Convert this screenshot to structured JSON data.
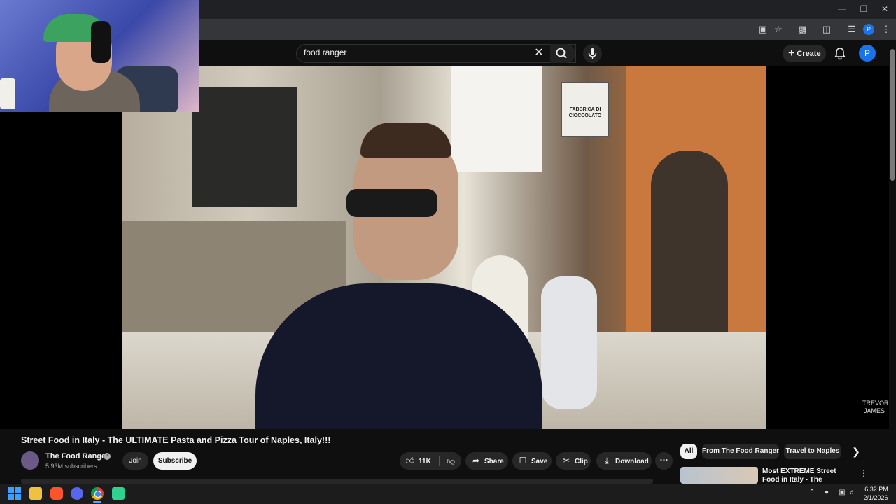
{
  "search": {
    "query": "food ranger"
  },
  "header": {
    "create_label": "Create",
    "avatar_letter": "P"
  },
  "browser": {
    "profile_letter": "P"
  },
  "video": {
    "title": "Street Food in Italy - The ULTIMATE Pasta and Pizza Tour of Naples, Italy!!!",
    "overlay_sign": "FABBRICA DI CIOCCOLATO",
    "watermark_line1": "TREVOR",
    "watermark_line2": "JAMES"
  },
  "channel": {
    "name": "The Food Ranger",
    "subscribers": "5.93M subscribers",
    "join_label": "Join",
    "subscribe_label": "Subscribe"
  },
  "actions": {
    "like_count": "11K",
    "share_label": "Share",
    "save_label": "Save",
    "clip_label": "Clip",
    "download_label": "Download"
  },
  "chips": [
    "All",
    "From The Food Ranger",
    "Travel to Naples"
  ],
  "recommendation": {
    "title": "Most EXTREME Street Food in Italy - The ULTIMATE Street"
  },
  "taskbar": {
    "time": "6:32 PM",
    "date": "2/1/2026"
  },
  "colors": {
    "background": "#0f0f0f",
    "pill": "#272727",
    "subscribe": "#f1f1f1",
    "avatar": "#1a73e8"
  }
}
